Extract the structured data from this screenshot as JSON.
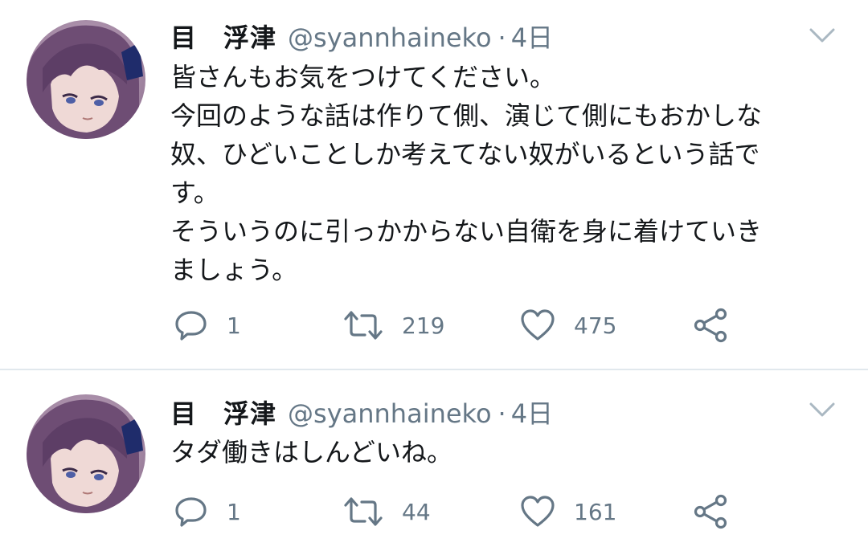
{
  "colors": {
    "text": "#14171a",
    "secondary": "#657786",
    "divider": "#e1e8ed",
    "background": "#ffffff"
  },
  "tweets": [
    {
      "author": {
        "display_name": "目　浮津",
        "handle": "@syannhaineko",
        "avatar_icon": "anime-girl-avatar"
      },
      "separator": "·",
      "time": "4日",
      "text_lines": [
        "皆さんもお気をつけてください。",
        "今回のような話は作りて側、演じて側にもおかしな",
        "奴、ひどいことしか考えてない奴がいるという話で",
        "す。",
        "そういうのに引っかからない自衛を身に着けていき",
        "ましょう。"
      ],
      "actions": {
        "reply_count": "1",
        "retweet_count": "219",
        "like_count": "475"
      }
    },
    {
      "author": {
        "display_name": "目　浮津",
        "handle": "@syannhaineko",
        "avatar_icon": "anime-girl-avatar"
      },
      "separator": "·",
      "time": "4日",
      "text_lines": [
        "タダ働きはしんどいね。"
      ],
      "actions": {
        "reply_count": "1",
        "retweet_count": "44",
        "like_count": "161"
      }
    }
  ]
}
